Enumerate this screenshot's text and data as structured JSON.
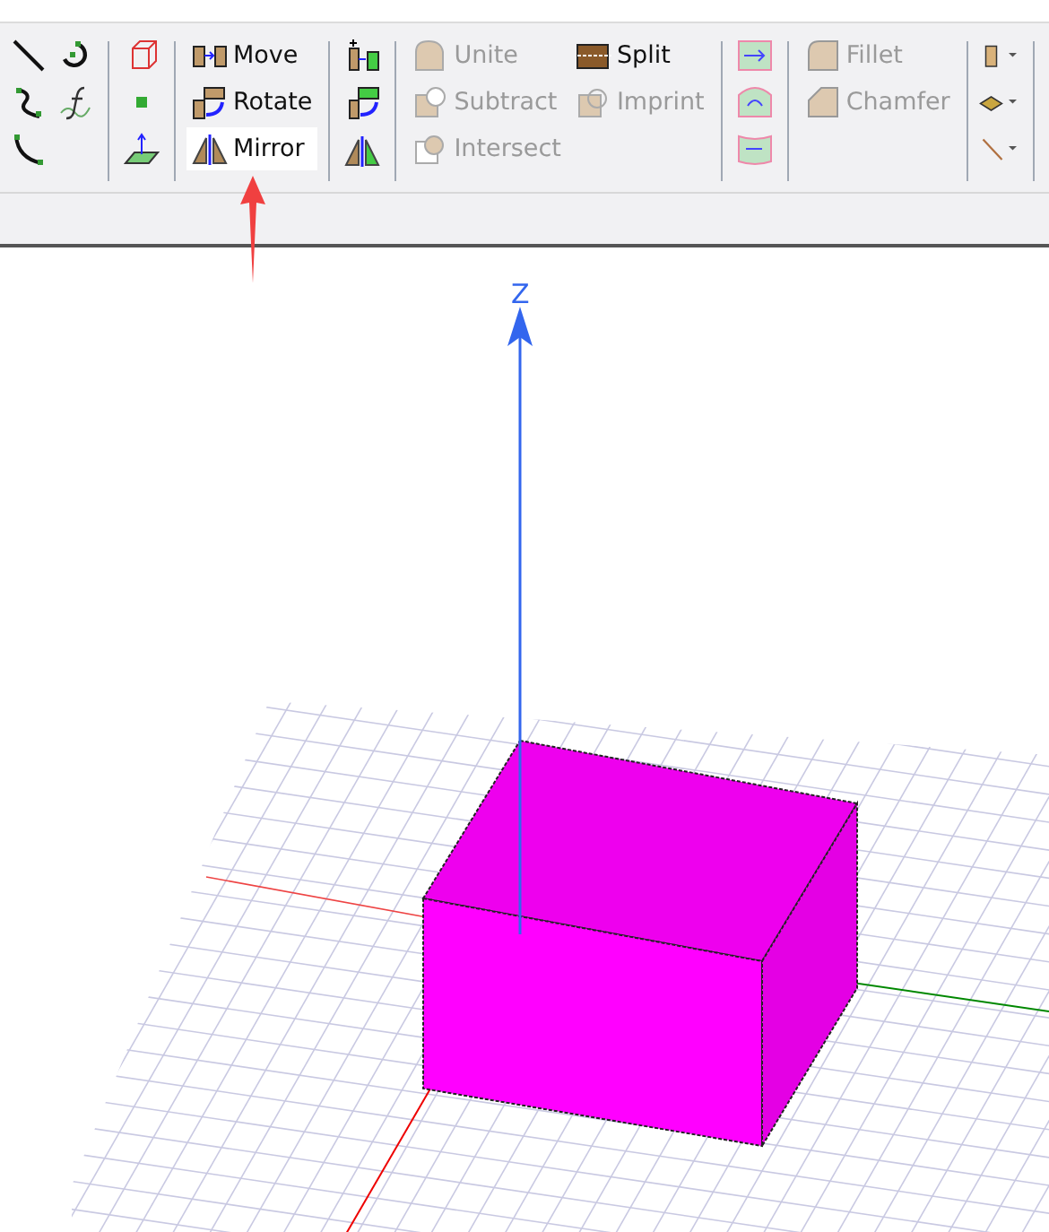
{
  "ribbon": {
    "transform_commands": [
      {
        "label": "Move",
        "disabled": false,
        "selected": false
      },
      {
        "label": "Rotate",
        "disabled": false,
        "selected": false
      },
      {
        "label": "Mirror",
        "disabled": false,
        "selected": true
      }
    ],
    "boolean_commands": [
      {
        "label": "Unite",
        "disabled": true
      },
      {
        "label": "Subtract",
        "disabled": true
      },
      {
        "label": "Intersect",
        "disabled": true
      }
    ],
    "split_commands": [
      {
        "label": "Split",
        "disabled": false
      },
      {
        "label": "Imprint",
        "disabled": true
      }
    ],
    "edge_commands": [
      {
        "label": "Fillet",
        "disabled": true
      },
      {
        "label": "Chamfer",
        "disabled": true
      }
    ]
  },
  "viewport": {
    "axis_label": "Z"
  }
}
